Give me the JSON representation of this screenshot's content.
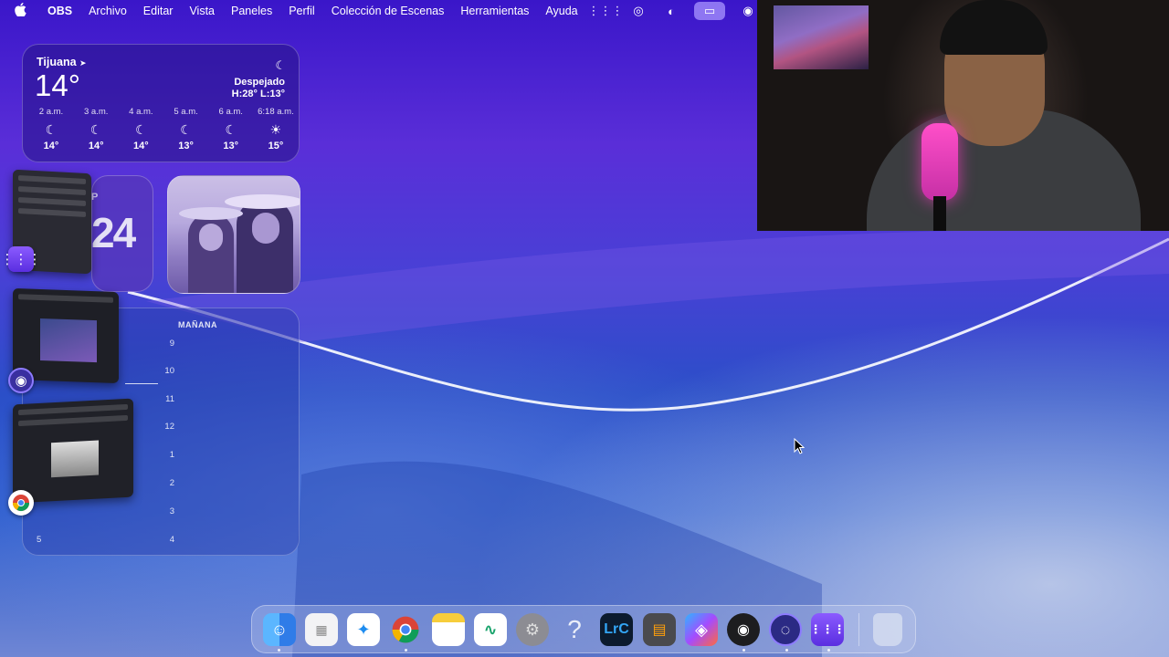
{
  "menubar": {
    "apple": "",
    "app_name": "OBS",
    "items": [
      "Archivo",
      "Editar",
      "Vista",
      "Paneles",
      "Perfil",
      "Colección de Escenas",
      "Herramientas",
      "Ayuda"
    ]
  },
  "weather": {
    "city": "Tijuana",
    "temperature": "14°",
    "condition": "Despejado",
    "high_low": "H:28° L:13°",
    "forecast": [
      {
        "time": "2 a.m.",
        "icon": "☾",
        "temp": "14°"
      },
      {
        "time": "3 a.m.",
        "icon": "☾",
        "temp": "14°"
      },
      {
        "time": "4 a.m.",
        "icon": "☾",
        "temp": "14°"
      },
      {
        "time": "5 a.m.",
        "icon": "☾",
        "temp": "13°"
      },
      {
        "time": "6 a.m.",
        "icon": "☾",
        "temp": "13°"
      },
      {
        "time": "6:18 a.m.",
        "icon": "☀",
        "temp": "15°"
      }
    ]
  },
  "calendar_small": {
    "letter": "P",
    "day": "24"
  },
  "calendar": {
    "header": "MAÑANA",
    "hours": [
      "9",
      "10",
      "11",
      "12",
      "1",
      "2",
      "3",
      "4"
    ],
    "left_number": "5"
  },
  "dock": {
    "apps": [
      "finder-icon",
      "launchpad-icon",
      "safari-icon",
      "chrome-icon",
      "notes-icon",
      "freeform-icon",
      "system-settings-icon",
      "help-icon",
      "lightroom-classic-icon",
      "calculator-icon",
      "copilot-icon",
      "obs-icon",
      "app-icon",
      "grid-app-icon",
      "trash-icon"
    ],
    "lightroom_label": "LrC"
  },
  "colors": {
    "accent": "#5a2ed8",
    "menu_active": "#aa96ff"
  }
}
